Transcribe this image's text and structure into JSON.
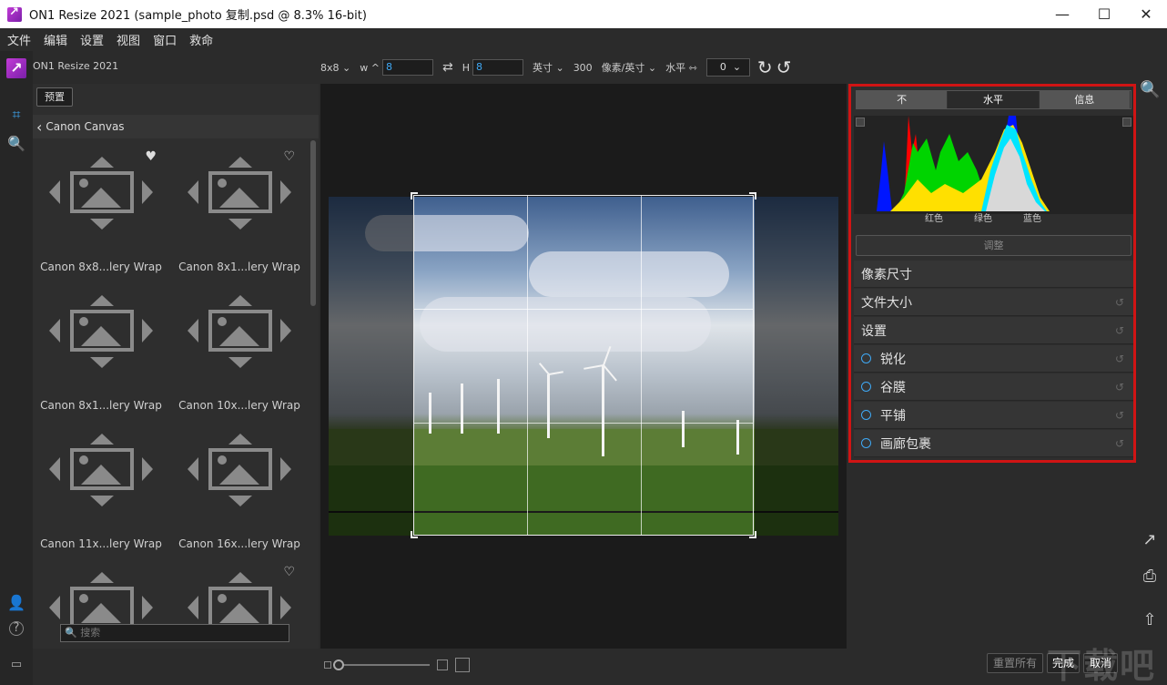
{
  "window": {
    "title": "ON1 Resize 2021 (sample_photo 复制.psd @ 8.3% 16-bit)",
    "min": "—",
    "max": "☐",
    "close": "✕"
  },
  "menu": [
    "文件",
    "编辑",
    "设置",
    "视图",
    "窗口",
    "救命"
  ],
  "brand": "ON1 Resize 2021",
  "toolbar": {
    "size_preset": "8x8",
    "w_label": "w",
    "w_value": "8",
    "h_label": "H",
    "h_value": "8",
    "unit": "英寸",
    "resolution": "300",
    "res_unit": "像素/英寸",
    "orientation": "水平",
    "rotation_value": "0"
  },
  "left_panel": {
    "preset_button": "预置",
    "breadcrumb": "Canon Canvas",
    "items": [
      {
        "label": "Canon 8x8...lery Wrap",
        "heart": "♥"
      },
      {
        "label": "Canon 8x1...lery Wrap",
        "heart": "♡"
      },
      {
        "label": "Canon 8x1...lery Wrap",
        "heart": ""
      },
      {
        "label": "Canon 10x...lery Wrap",
        "heart": ""
      },
      {
        "label": "Canon 11x...lery Wrap",
        "heart": ""
      },
      {
        "label": "Canon 16x...lery Wrap",
        "heart": ""
      },
      {
        "label": "",
        "heart": ""
      },
      {
        "label": "",
        "heart": "♡"
      }
    ],
    "search_placeholder": "搜索"
  },
  "right_panel": {
    "tabs": [
      "不",
      "水平",
      "信息"
    ],
    "active_tab": 1,
    "histogram_labels": [
      "红色",
      "绿色",
      "蓝色"
    ],
    "adjust_button": "调整",
    "sections": [
      {
        "label": "像素尺寸",
        "circle": false,
        "reset": false
      },
      {
        "label": "文件大小",
        "circle": false,
        "reset": true
      },
      {
        "label": "设置",
        "circle": false,
        "reset": true
      },
      {
        "label": "锐化",
        "circle": true,
        "reset": true
      },
      {
        "label": "谷膜",
        "circle": true,
        "reset": true
      },
      {
        "label": "平铺",
        "circle": true,
        "reset": true
      },
      {
        "label": "画廊包裹",
        "circle": true,
        "reset": true
      }
    ]
  },
  "bottom": {
    "reset_all": "重置所有",
    "done": "完成",
    "cancel": "取消"
  },
  "watermark": "下载吧"
}
